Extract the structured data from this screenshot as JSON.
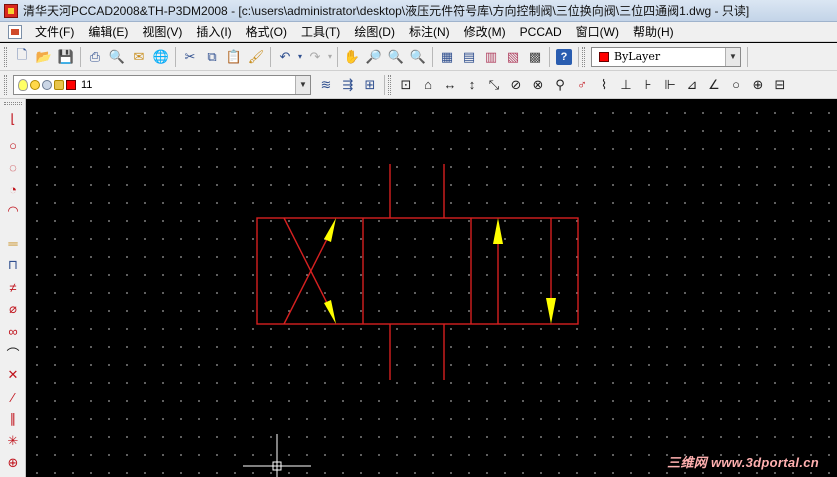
{
  "window": {
    "title": "清华天河PCCAD2008&TH-P3DM2008 - [c:\\users\\administrator\\desktop\\液压元件符号库\\方向控制阀\\三位换向阀\\三位四通阀1.dwg - 只读]"
  },
  "menu": [
    {
      "label": "文件(F)"
    },
    {
      "label": "编辑(E)"
    },
    {
      "label": "视图(V)"
    },
    {
      "label": "插入(I)"
    },
    {
      "label": "格式(O)"
    },
    {
      "label": "工具(T)"
    },
    {
      "label": "绘图(D)"
    },
    {
      "label": "标注(N)"
    },
    {
      "label": "修改(M)"
    },
    {
      "label": "PCCAD"
    },
    {
      "label": "窗口(W)"
    },
    {
      "label": "帮助(H)"
    }
  ],
  "toolbar": {
    "color_select": "ByLayer",
    "layer_select": "11"
  },
  "colors": {
    "symbol_lines": "#d62020",
    "arrows": "#ffff00",
    "cursor": "#ffffff",
    "layer_swatch": "#ff0000"
  },
  "icons": {
    "standard": [
      "new-file-icon",
      "open-file-icon",
      "save-icon",
      "print-icon",
      "print-preview-icon",
      "publish-icon",
      "plot-icon",
      "cut-icon",
      "copy-icon",
      "paste-icon",
      "match-properties-icon",
      "undo-icon",
      "redo-icon",
      "pan-icon",
      "zoom-realtime-icon",
      "zoom-window-icon",
      "zoom-previous-icon",
      "properties-icon",
      "design-center-icon",
      "tool-palette-icon",
      "calculator-icon",
      "help-icon"
    ],
    "left": [
      "line-icon",
      "circle-icon",
      "circle-3p-icon",
      "arc-icon",
      "hatch-icon",
      "block-icon",
      "dimension-icon",
      "chamfer-icon",
      "offset-icon",
      "fillet-icon",
      "extend-icon",
      "trim-icon",
      "explode-icon",
      "center-mark-icon"
    ]
  },
  "watermark": "三维网 www.3dportal.cn"
}
